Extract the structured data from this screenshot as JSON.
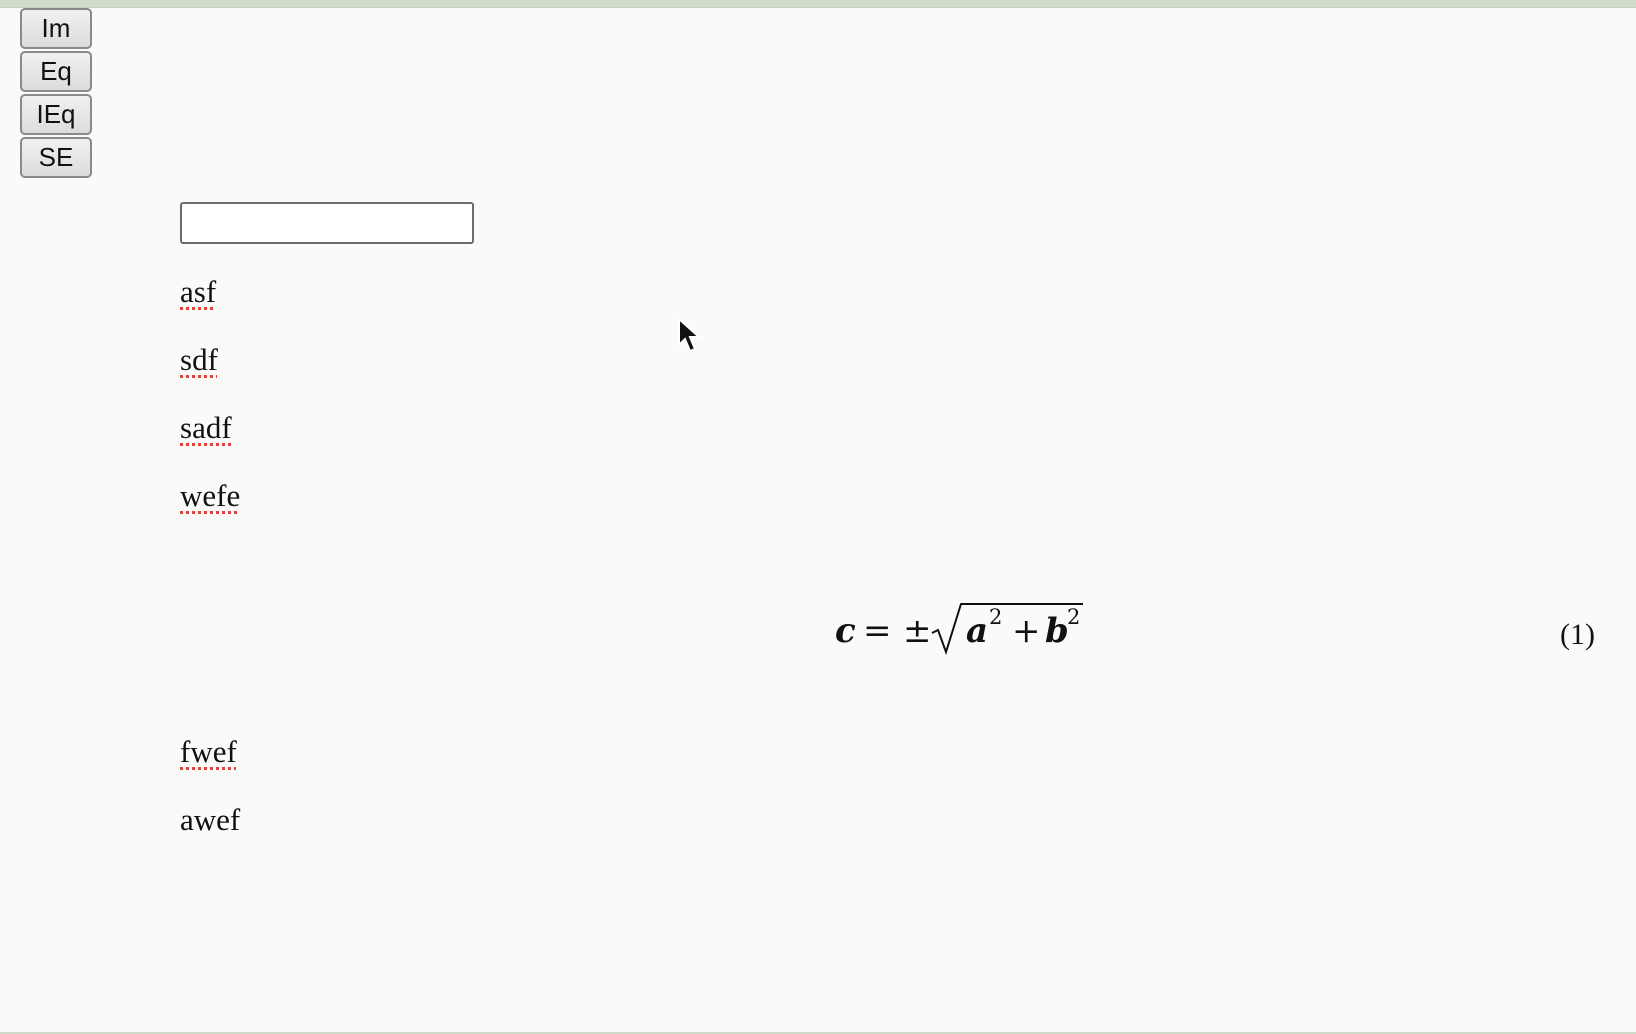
{
  "toolbar": {
    "buttons": [
      "Im",
      "Eq",
      "IEq",
      "SE"
    ]
  },
  "editor": {
    "input_value": "",
    "paragraphs_before": [
      "asf",
      "sdf",
      "sadf",
      "wefe"
    ],
    "equation": {
      "lhs": "c",
      "equals": "=",
      "pm": "±",
      "a": "a",
      "a_exp": "2",
      "plus": "+",
      "b": "b",
      "b_exp": "2",
      "number": "(1)"
    },
    "paragraphs_after": [
      "fwef",
      "awef"
    ]
  },
  "icons": {
    "pointer": "mouse-pointer-icon"
  },
  "colors": {
    "spellcheck": "#e0443f",
    "top_strip": "#cfdcc9"
  }
}
